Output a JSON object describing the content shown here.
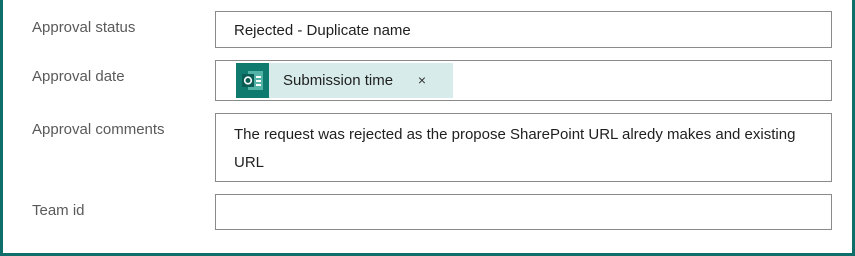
{
  "form": {
    "approval_status": {
      "label": "Approval status",
      "value": "Rejected - Duplicate name"
    },
    "approval_date": {
      "label": "Approval date",
      "token": {
        "label": "Submission time",
        "remove_glyph": "×",
        "icon": "forms-icon"
      }
    },
    "approval_comments": {
      "label": "Approval comments",
      "value": "The request was rejected as the propose SharePoint URL alredy makes and existing URL"
    },
    "team_id": {
      "label": "Team id",
      "value": ""
    }
  },
  "colors": {
    "accent": "#0f6e6a",
    "token_bg": "#d7ecea",
    "border": "#8a8a8a",
    "label": "#5a5a5a"
  }
}
